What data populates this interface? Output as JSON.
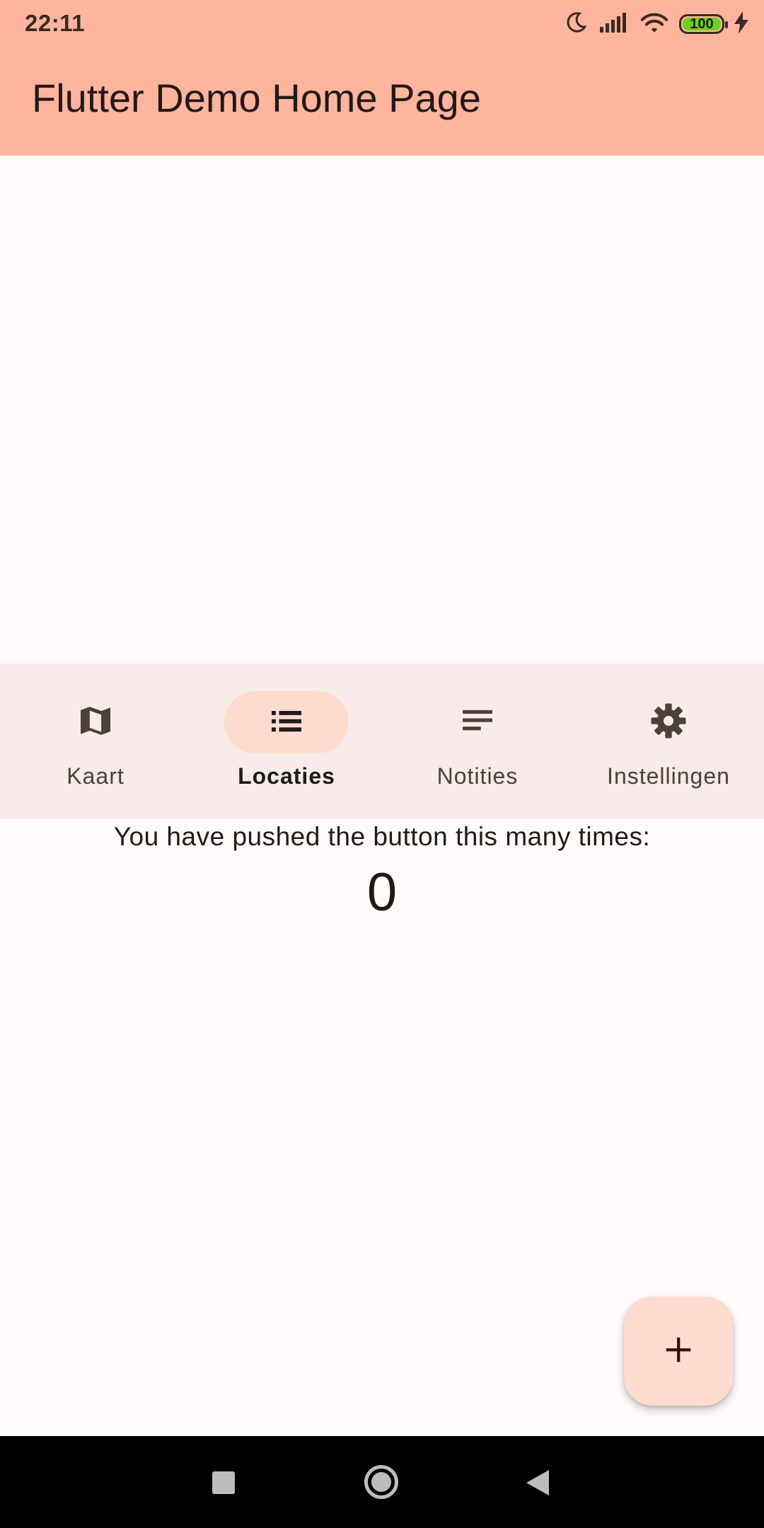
{
  "status_bar": {
    "time": "22:11",
    "battery_level": "100",
    "icons": [
      "moon-icon",
      "signal-icon",
      "wifi-icon",
      "battery-icon",
      "charging-icon"
    ]
  },
  "app_bar": {
    "title": "Flutter Demo Home Page"
  },
  "navigation": {
    "items": [
      {
        "label": "Kaart",
        "icon": "map-icon"
      },
      {
        "label": "Locaties",
        "icon": "list-icon"
      },
      {
        "label": "Notities",
        "icon": "notes-icon"
      },
      {
        "label": "Instellingen",
        "icon": "gear-icon"
      }
    ],
    "selected_label": "Locaties"
  },
  "counter": {
    "caption": "You have pushed the button this many times:",
    "value": "0"
  },
  "fab": {
    "icon": "plus-icon"
  },
  "colors": {
    "primary_container": "#ffb59d",
    "nav_background": "#f7ece9",
    "indicator": "#ffdbd0",
    "fab": "#ffdbd0",
    "surface": "#fffbfb",
    "battery_fill": "#6bd11d"
  }
}
